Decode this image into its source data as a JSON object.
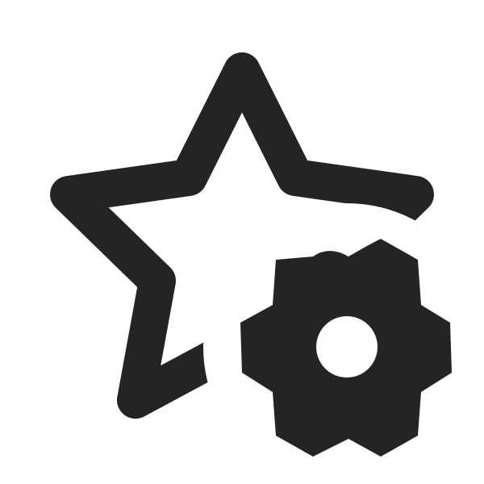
{
  "icon": {
    "name": "star-settings-icon",
    "parts": [
      "star-outline-icon",
      "gear-icon"
    ],
    "colors": {
      "stroke": "#242424",
      "fill": "#242424",
      "background": "#ffffff"
    }
  }
}
